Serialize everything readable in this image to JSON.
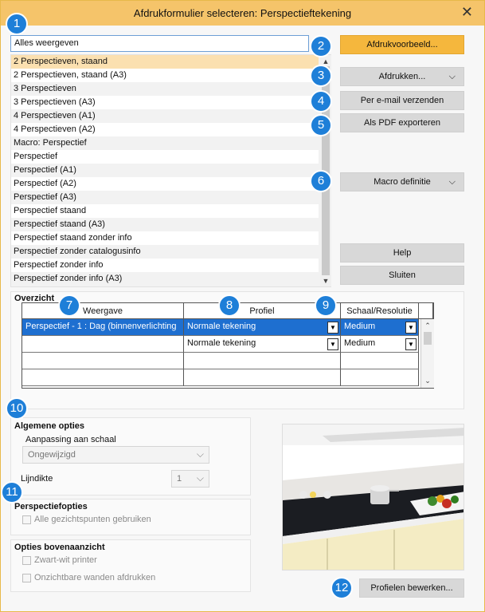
{
  "window": {
    "title": "Afdrukformulier selecteren: Perspectieftekening",
    "close_glyph": "✕"
  },
  "badges": [
    "1",
    "2",
    "3",
    "4",
    "5",
    "6",
    "7",
    "8",
    "9",
    "10",
    "11",
    "12"
  ],
  "filter": {
    "value": "Alles weergeven"
  },
  "templates": [
    "2 Perspectieven, staand",
    "2 Perspectieven, staand (A3)",
    "3 Perspectieven",
    "3 Perspectieven (A3)",
    "4 Perspectieven (A1)",
    "4 Perspectieven (A2)",
    "Macro: Perspectief",
    "Perspectief",
    "Perspectief (A1)",
    "Perspectief (A2)",
    "Perspectief (A3)",
    "Perspectief staand",
    "Perspectief staand (A3)",
    "Perspectief staand zonder info",
    "Perspectief zonder catalogusinfo",
    "Perspectief zonder info",
    "Perspectief zonder info (A3)"
  ],
  "selected_template": "2 Perspectieven, staand",
  "buttons": {
    "preview": "Afdrukvoorbeeld...",
    "print": "Afdrukken...",
    "email": "Per e-mail verzenden",
    "pdf": "Als PDF exporteren",
    "macro": "Macro definitie",
    "help": "Help",
    "close": "Sluiten",
    "edit_profiles": "Profielen bewerken..."
  },
  "overview": {
    "title": "Overzicht",
    "columns": [
      "Weergave",
      "Profiel",
      "Schaal/Resolutie"
    ],
    "rows": [
      {
        "view": "Perspectief - 1 : Dag (binnenverlichting",
        "profile": "Normale tekening",
        "scale": "Medium",
        "selected": true
      },
      {
        "view": "",
        "profile": "Normale tekening",
        "scale": "Medium",
        "selected": false
      },
      {
        "view": "",
        "profile": "",
        "scale": "",
        "selected": false
      },
      {
        "view": "",
        "profile": "",
        "scale": "",
        "selected": false
      }
    ]
  },
  "general_options": {
    "title": "Algemene opties",
    "scale_label": "Aanpassing aan schaal",
    "scale_value": "Ongewijzigd",
    "line_label": "Lijndikte",
    "line_value": "1"
  },
  "perspective_options": {
    "title": "Perspectiefopties",
    "all_viewpoints": "Alle gezichtspunten gebruiken",
    "all_viewpoints_checked": false
  },
  "top_view_options": {
    "title": "Opties bovenaanzicht",
    "bw_printer": "Zwart-wit printer",
    "bw_printer_checked": false,
    "invisible_walls": "Onzichtbare wanden afdrukken",
    "invisible_walls_checked": false
  },
  "colors": {
    "title_bar": "#f5c46a",
    "primary_button": "#f5b73d",
    "badge": "#1e7fd8",
    "selection": "#1e6fd0",
    "list_selected": "#fbe0b0"
  }
}
